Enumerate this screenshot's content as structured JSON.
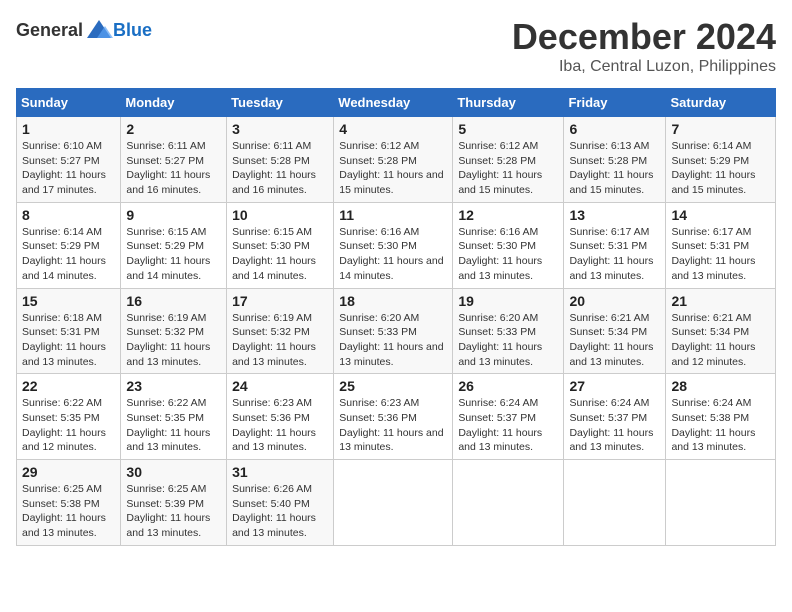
{
  "header": {
    "logo_general": "General",
    "logo_blue": "Blue",
    "title": "December 2024",
    "subtitle": "Iba, Central Luzon, Philippines"
  },
  "calendar": {
    "days_of_week": [
      "Sunday",
      "Monday",
      "Tuesday",
      "Wednesday",
      "Thursday",
      "Friday",
      "Saturday"
    ],
    "weeks": [
      [
        {
          "day": "1",
          "sunrise": "6:10 AM",
          "sunset": "5:27 PM",
          "daylight": "11 hours and 17 minutes."
        },
        {
          "day": "2",
          "sunrise": "6:11 AM",
          "sunset": "5:27 PM",
          "daylight": "11 hours and 16 minutes."
        },
        {
          "day": "3",
          "sunrise": "6:11 AM",
          "sunset": "5:28 PM",
          "daylight": "11 hours and 16 minutes."
        },
        {
          "day": "4",
          "sunrise": "6:12 AM",
          "sunset": "5:28 PM",
          "daylight": "11 hours and 15 minutes."
        },
        {
          "day": "5",
          "sunrise": "6:12 AM",
          "sunset": "5:28 PM",
          "daylight": "11 hours and 15 minutes."
        },
        {
          "day": "6",
          "sunrise": "6:13 AM",
          "sunset": "5:28 PM",
          "daylight": "11 hours and 15 minutes."
        },
        {
          "day": "7",
          "sunrise": "6:14 AM",
          "sunset": "5:29 PM",
          "daylight": "11 hours and 15 minutes."
        }
      ],
      [
        {
          "day": "8",
          "sunrise": "6:14 AM",
          "sunset": "5:29 PM",
          "daylight": "11 hours and 14 minutes."
        },
        {
          "day": "9",
          "sunrise": "6:15 AM",
          "sunset": "5:29 PM",
          "daylight": "11 hours and 14 minutes."
        },
        {
          "day": "10",
          "sunrise": "6:15 AM",
          "sunset": "5:30 PM",
          "daylight": "11 hours and 14 minutes."
        },
        {
          "day": "11",
          "sunrise": "6:16 AM",
          "sunset": "5:30 PM",
          "daylight": "11 hours and 14 minutes."
        },
        {
          "day": "12",
          "sunrise": "6:16 AM",
          "sunset": "5:30 PM",
          "daylight": "11 hours and 13 minutes."
        },
        {
          "day": "13",
          "sunrise": "6:17 AM",
          "sunset": "5:31 PM",
          "daylight": "11 hours and 13 minutes."
        },
        {
          "day": "14",
          "sunrise": "6:17 AM",
          "sunset": "5:31 PM",
          "daylight": "11 hours and 13 minutes."
        }
      ],
      [
        {
          "day": "15",
          "sunrise": "6:18 AM",
          "sunset": "5:31 PM",
          "daylight": "11 hours and 13 minutes."
        },
        {
          "day": "16",
          "sunrise": "6:19 AM",
          "sunset": "5:32 PM",
          "daylight": "11 hours and 13 minutes."
        },
        {
          "day": "17",
          "sunrise": "6:19 AM",
          "sunset": "5:32 PM",
          "daylight": "11 hours and 13 minutes."
        },
        {
          "day": "18",
          "sunrise": "6:20 AM",
          "sunset": "5:33 PM",
          "daylight": "11 hours and 13 minutes."
        },
        {
          "day": "19",
          "sunrise": "6:20 AM",
          "sunset": "5:33 PM",
          "daylight": "11 hours and 13 minutes."
        },
        {
          "day": "20",
          "sunrise": "6:21 AM",
          "sunset": "5:34 PM",
          "daylight": "11 hours and 13 minutes."
        },
        {
          "day": "21",
          "sunrise": "6:21 AM",
          "sunset": "5:34 PM",
          "daylight": "11 hours and 12 minutes."
        }
      ],
      [
        {
          "day": "22",
          "sunrise": "6:22 AM",
          "sunset": "5:35 PM",
          "daylight": "11 hours and 12 minutes."
        },
        {
          "day": "23",
          "sunrise": "6:22 AM",
          "sunset": "5:35 PM",
          "daylight": "11 hours and 13 minutes."
        },
        {
          "day": "24",
          "sunrise": "6:23 AM",
          "sunset": "5:36 PM",
          "daylight": "11 hours and 13 minutes."
        },
        {
          "day": "25",
          "sunrise": "6:23 AM",
          "sunset": "5:36 PM",
          "daylight": "11 hours and 13 minutes."
        },
        {
          "day": "26",
          "sunrise": "6:24 AM",
          "sunset": "5:37 PM",
          "daylight": "11 hours and 13 minutes."
        },
        {
          "day": "27",
          "sunrise": "6:24 AM",
          "sunset": "5:37 PM",
          "daylight": "11 hours and 13 minutes."
        },
        {
          "day": "28",
          "sunrise": "6:24 AM",
          "sunset": "5:38 PM",
          "daylight": "11 hours and 13 minutes."
        }
      ],
      [
        {
          "day": "29",
          "sunrise": "6:25 AM",
          "sunset": "5:38 PM",
          "daylight": "11 hours and 13 minutes."
        },
        {
          "day": "30",
          "sunrise": "6:25 AM",
          "sunset": "5:39 PM",
          "daylight": "11 hours and 13 minutes."
        },
        {
          "day": "31",
          "sunrise": "6:26 AM",
          "sunset": "5:40 PM",
          "daylight": "11 hours and 13 minutes."
        },
        null,
        null,
        null,
        null
      ]
    ]
  }
}
